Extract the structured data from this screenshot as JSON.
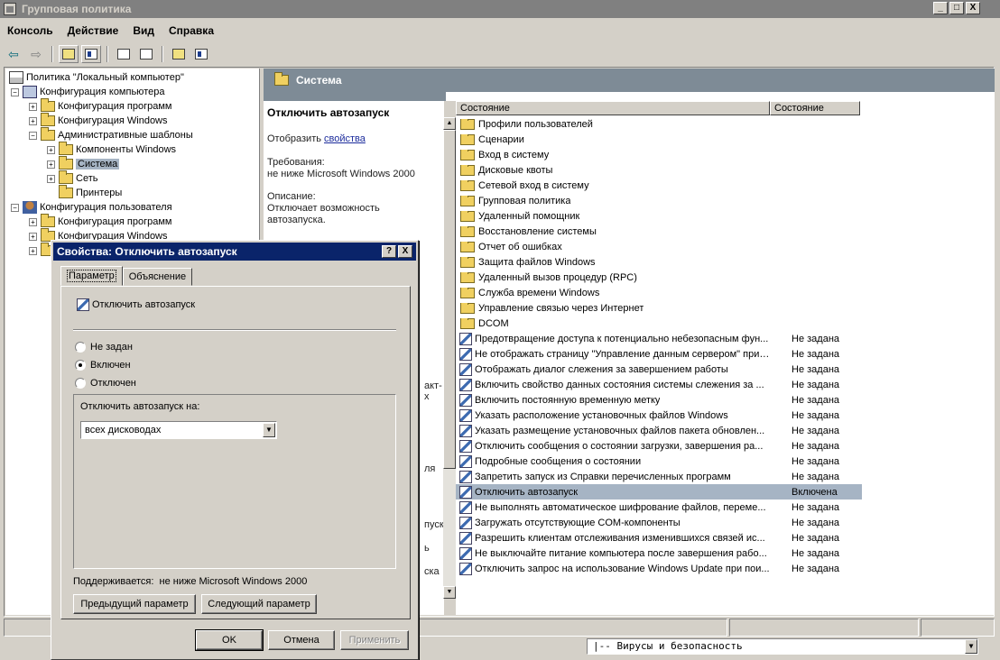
{
  "window": {
    "title": "Групповая политика",
    "buttons": [
      "_",
      "□",
      "X"
    ]
  },
  "menu": [
    "Консоль",
    "Действие",
    "Вид",
    "Справка"
  ],
  "tree": {
    "root": "Политика \"Локальный компьютер\"",
    "nodes": [
      {
        "label": "Конфигурация компьютера",
        "expander": "−"
      },
      {
        "label": "Конфигурация программ",
        "expander": "+"
      },
      {
        "label": "Конфигурация Windows",
        "expander": "+"
      },
      {
        "label": "Административные шаблоны",
        "expander": "−"
      },
      {
        "label": "Компоненты Windows",
        "expander": "+"
      },
      {
        "label": "Система",
        "expander": "+"
      },
      {
        "label": "Сеть",
        "expander": "+"
      },
      {
        "label": "Принтеры",
        "expander": ""
      },
      {
        "label": "Конфигурация пользователя",
        "expander": "−"
      },
      {
        "label": "Конфигурация программ",
        "expander": "+"
      },
      {
        "label": "Конфигурация Windows",
        "expander": "+"
      },
      {
        "label": "",
        "expander": "+"
      }
    ]
  },
  "header_band": {
    "title": "Система"
  },
  "description": {
    "title": "Отключить автозапуск",
    "show": "Отобразить",
    "properties_link": "свойства",
    "requirements_label": "Требования:",
    "requirements_value": "не ниже Microsoft Windows 2000",
    "description_label": "Описание:",
    "description_line1": "Отключает возможность",
    "description_line2": "автозапуска.",
    "partial_1": "акт-",
    "partial_2": "х",
    "partial_3": "ля",
    "partial_4": "пуск",
    "partial_5": "ь",
    "partial_6": "ска"
  },
  "list": {
    "columns": [
      "Состояние",
      "Состояние"
    ],
    "rows": [
      {
        "type": "folder",
        "name": "Профили пользователей",
        "state": ""
      },
      {
        "type": "folder",
        "name": "Сценарии",
        "state": ""
      },
      {
        "type": "folder",
        "name": "Вход в систему",
        "state": ""
      },
      {
        "type": "folder",
        "name": "Дисковые квоты",
        "state": ""
      },
      {
        "type": "folder",
        "name": "Сетевой вход в систему",
        "state": ""
      },
      {
        "type": "folder",
        "name": "Групповая политика",
        "state": ""
      },
      {
        "type": "folder",
        "name": "Удаленный помощник",
        "state": ""
      },
      {
        "type": "folder",
        "name": "Восстановление системы",
        "state": ""
      },
      {
        "type": "folder",
        "name": "Отчет об ошибках",
        "state": ""
      },
      {
        "type": "folder",
        "name": "Защита файлов Windows",
        "state": ""
      },
      {
        "type": "folder",
        "name": "Удаленный вызов процедур (RPC)",
        "state": ""
      },
      {
        "type": "folder",
        "name": "Служба времени Windows",
        "state": ""
      },
      {
        "type": "folder",
        "name": "Управление связью через Интернет",
        "state": ""
      },
      {
        "type": "folder",
        "name": "DCOM",
        "state": ""
      },
      {
        "type": "setting",
        "name": "Предотвращение доступа к потенциально небезопасным фун...",
        "state": "Не задана"
      },
      {
        "type": "setting",
        "name": "Не отображать страницу \"Управление данным сервером\" при ...",
        "state": "Не задана"
      },
      {
        "type": "setting",
        "name": "Отображать диалог слежения за завершением работы",
        "state": "Не задана"
      },
      {
        "type": "setting",
        "name": "Включить свойство данных состояния системы слежения за ...",
        "state": "Не задана"
      },
      {
        "type": "setting",
        "name": "Включить постоянную временную метку",
        "state": "Не задана"
      },
      {
        "type": "setting",
        "name": "Указать расположение установочных файлов Windows",
        "state": "Не задана"
      },
      {
        "type": "setting",
        "name": "Указать размещение установочных файлов пакета обновлен...",
        "state": "Не задана"
      },
      {
        "type": "setting",
        "name": "Отключить сообщения о состоянии загрузки, завершения ра...",
        "state": "Не задана"
      },
      {
        "type": "setting",
        "name": "Подробные сообщения о состоянии",
        "state": "Не задана"
      },
      {
        "type": "setting",
        "name": "Запретить запуск из Справки перечисленных программ",
        "state": "Не задана"
      },
      {
        "type": "setting",
        "name": "Отключить автозапуск",
        "state": "Включена",
        "selected": true
      },
      {
        "type": "setting",
        "name": "Не выполнять автоматическое шифрование файлов, переме...",
        "state": "Не задана"
      },
      {
        "type": "setting",
        "name": "Загружать отсутствующие COM-компоненты",
        "state": "Не задана"
      },
      {
        "type": "setting",
        "name": "Разрешить клиентам отслеживания изменившихся связей ис...",
        "state": "Не задана"
      },
      {
        "type": "setting",
        "name": "Не выключайте питание компьютера после завершения рабо...",
        "state": "Не задана"
      },
      {
        "type": "setting",
        "name": "Отключить запрос на использование Windows Update при пои...",
        "state": "Не задана"
      }
    ]
  },
  "bottom_combo": {
    "value": "|-- Вирусы и безопасность"
  },
  "dialog": {
    "title": "Свойства: Отключить автозапуск",
    "title_buttons": [
      "?",
      "X"
    ],
    "tabs": [
      "Параметр",
      "Объяснение"
    ],
    "setting_name": "Отключить автозапуск",
    "radios": [
      {
        "label": "Не задан",
        "checked": false
      },
      {
        "label": "Включен",
        "checked": true
      },
      {
        "label": "Отключен",
        "checked": false
      }
    ],
    "options_label": "Отключить автозапуск на:",
    "options_value": "всех дисководах",
    "supported_label": "Поддерживается:",
    "supported_value": "не ниже Microsoft Windows 2000",
    "prev_button": "Предыдущий параметр",
    "next_button": "Следующий параметр",
    "ok_button": "OK",
    "cancel_button": "Отмена",
    "apply_button": "Применить"
  }
}
